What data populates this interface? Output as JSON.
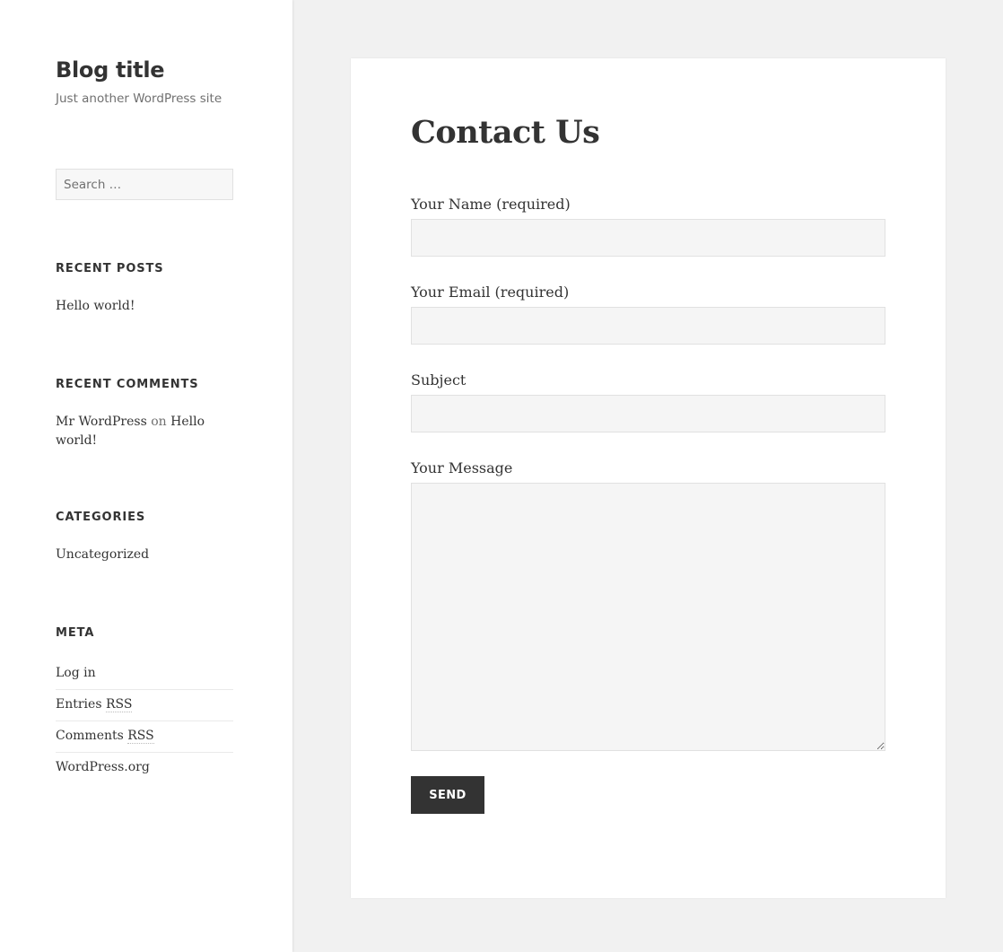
{
  "site": {
    "title": "Blog title",
    "description": "Just another WordPress site"
  },
  "search": {
    "placeholder": "Search …"
  },
  "widgets": {
    "recent_posts": {
      "title": "RECENT POSTS",
      "items": [
        "Hello world!"
      ]
    },
    "recent_comments": {
      "title": "RECENT COMMENTS",
      "author": "Mr WordPress",
      "connector": "on",
      "post_line1": "Hello",
      "post_line2": "world!"
    },
    "categories": {
      "title": "CATEGORIES",
      "items": [
        "Uncategorized"
      ]
    },
    "meta": {
      "title": "META",
      "items": [
        {
          "prefix": "Log in",
          "abbr": ""
        },
        {
          "prefix": "Entries ",
          "abbr": "RSS"
        },
        {
          "prefix": "Comments ",
          "abbr": "RSS"
        },
        {
          "prefix": "WordPress.org",
          "abbr": ""
        }
      ]
    }
  },
  "page": {
    "title": "Contact Us"
  },
  "form": {
    "name_label": "Your Name (required)",
    "name_value": "",
    "email_label": "Your Email (required)",
    "email_value": "",
    "subject_label": "Subject",
    "subject_value": "",
    "message_label": "Your Message",
    "message_value": "",
    "send_label": "SEND"
  },
  "colors": {
    "background": "#f1f1f1",
    "text": "#333333",
    "muted": "#707070",
    "input_bg": "#f5f5f5",
    "button_bg": "#333333"
  }
}
